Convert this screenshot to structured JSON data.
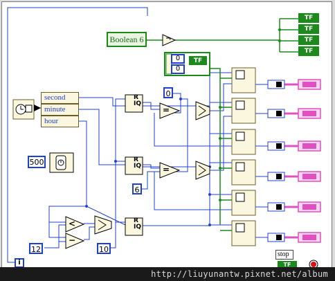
{
  "diagram": {
    "boolean_label": "Boolean 6",
    "tf_label": "TF",
    "cluster_fields": [
      "second",
      "minute",
      "hour"
    ],
    "constants": {
      "wait_ms": "500",
      "zero": "0",
      "six": "6",
      "ten": "10",
      "twelve": "12",
      "array_index_0": "0",
      "array_index_1": "0"
    },
    "quotient_label": "R",
    "quotient_label_2": "IQ",
    "compare_symbols": {
      "equal": "=",
      "less": "<",
      "minus": "−",
      "not": "¬"
    },
    "stop_label": "stop",
    "info_label": "i",
    "array_ctrl_label": "TF"
  },
  "footer": {
    "url": "http://liuyunantw.pixnet.net/album"
  },
  "colors": {
    "wire_blue": "#1f3fd0",
    "wire_green": "#1a8a1a",
    "wire_pink": "#e050c0",
    "border": "#6a5c2a"
  }
}
